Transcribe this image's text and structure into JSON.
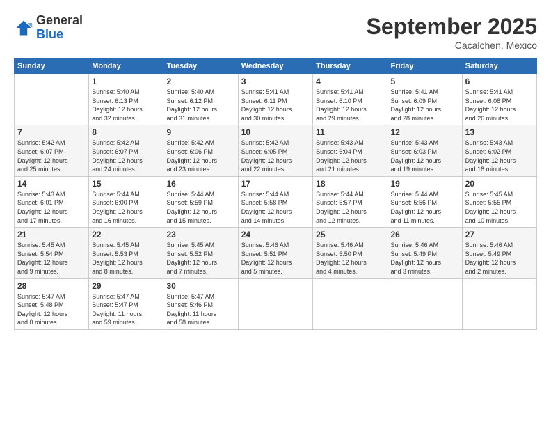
{
  "header": {
    "logo_general": "General",
    "logo_blue": "Blue",
    "month_title": "September 2025",
    "location": "Cacalchen, Mexico"
  },
  "weekdays": [
    "Sunday",
    "Monday",
    "Tuesday",
    "Wednesday",
    "Thursday",
    "Friday",
    "Saturday"
  ],
  "weeks": [
    [
      {
        "day": "",
        "info": ""
      },
      {
        "day": "1",
        "info": "Sunrise: 5:40 AM\nSunset: 6:13 PM\nDaylight: 12 hours\nand 32 minutes."
      },
      {
        "day": "2",
        "info": "Sunrise: 5:40 AM\nSunset: 6:12 PM\nDaylight: 12 hours\nand 31 minutes."
      },
      {
        "day": "3",
        "info": "Sunrise: 5:41 AM\nSunset: 6:11 PM\nDaylight: 12 hours\nand 30 minutes."
      },
      {
        "day": "4",
        "info": "Sunrise: 5:41 AM\nSunset: 6:10 PM\nDaylight: 12 hours\nand 29 minutes."
      },
      {
        "day": "5",
        "info": "Sunrise: 5:41 AM\nSunset: 6:09 PM\nDaylight: 12 hours\nand 28 minutes."
      },
      {
        "day": "6",
        "info": "Sunrise: 5:41 AM\nSunset: 6:08 PM\nDaylight: 12 hours\nand 26 minutes."
      }
    ],
    [
      {
        "day": "7",
        "info": "Sunrise: 5:42 AM\nSunset: 6:07 PM\nDaylight: 12 hours\nand 25 minutes."
      },
      {
        "day": "8",
        "info": "Sunrise: 5:42 AM\nSunset: 6:07 PM\nDaylight: 12 hours\nand 24 minutes."
      },
      {
        "day": "9",
        "info": "Sunrise: 5:42 AM\nSunset: 6:06 PM\nDaylight: 12 hours\nand 23 minutes."
      },
      {
        "day": "10",
        "info": "Sunrise: 5:42 AM\nSunset: 6:05 PM\nDaylight: 12 hours\nand 22 minutes."
      },
      {
        "day": "11",
        "info": "Sunrise: 5:43 AM\nSunset: 6:04 PM\nDaylight: 12 hours\nand 21 minutes."
      },
      {
        "day": "12",
        "info": "Sunrise: 5:43 AM\nSunset: 6:03 PM\nDaylight: 12 hours\nand 19 minutes."
      },
      {
        "day": "13",
        "info": "Sunrise: 5:43 AM\nSunset: 6:02 PM\nDaylight: 12 hours\nand 18 minutes."
      }
    ],
    [
      {
        "day": "14",
        "info": "Sunrise: 5:43 AM\nSunset: 6:01 PM\nDaylight: 12 hours\nand 17 minutes."
      },
      {
        "day": "15",
        "info": "Sunrise: 5:44 AM\nSunset: 6:00 PM\nDaylight: 12 hours\nand 16 minutes."
      },
      {
        "day": "16",
        "info": "Sunrise: 5:44 AM\nSunset: 5:59 PM\nDaylight: 12 hours\nand 15 minutes."
      },
      {
        "day": "17",
        "info": "Sunrise: 5:44 AM\nSunset: 5:58 PM\nDaylight: 12 hours\nand 14 minutes."
      },
      {
        "day": "18",
        "info": "Sunrise: 5:44 AM\nSunset: 5:57 PM\nDaylight: 12 hours\nand 12 minutes."
      },
      {
        "day": "19",
        "info": "Sunrise: 5:44 AM\nSunset: 5:56 PM\nDaylight: 12 hours\nand 11 minutes."
      },
      {
        "day": "20",
        "info": "Sunrise: 5:45 AM\nSunset: 5:55 PM\nDaylight: 12 hours\nand 10 minutes."
      }
    ],
    [
      {
        "day": "21",
        "info": "Sunrise: 5:45 AM\nSunset: 5:54 PM\nDaylight: 12 hours\nand 9 minutes."
      },
      {
        "day": "22",
        "info": "Sunrise: 5:45 AM\nSunset: 5:53 PM\nDaylight: 12 hours\nand 8 minutes."
      },
      {
        "day": "23",
        "info": "Sunrise: 5:45 AM\nSunset: 5:52 PM\nDaylight: 12 hours\nand 7 minutes."
      },
      {
        "day": "24",
        "info": "Sunrise: 5:46 AM\nSunset: 5:51 PM\nDaylight: 12 hours\nand 5 minutes."
      },
      {
        "day": "25",
        "info": "Sunrise: 5:46 AM\nSunset: 5:50 PM\nDaylight: 12 hours\nand 4 minutes."
      },
      {
        "day": "26",
        "info": "Sunrise: 5:46 AM\nSunset: 5:49 PM\nDaylight: 12 hours\nand 3 minutes."
      },
      {
        "day": "27",
        "info": "Sunrise: 5:46 AM\nSunset: 5:49 PM\nDaylight: 12 hours\nand 2 minutes."
      }
    ],
    [
      {
        "day": "28",
        "info": "Sunrise: 5:47 AM\nSunset: 5:48 PM\nDaylight: 12 hours\nand 0 minutes."
      },
      {
        "day": "29",
        "info": "Sunrise: 5:47 AM\nSunset: 5:47 PM\nDaylight: 11 hours\nand 59 minutes."
      },
      {
        "day": "30",
        "info": "Sunrise: 5:47 AM\nSunset: 5:46 PM\nDaylight: 11 hours\nand 58 minutes."
      },
      {
        "day": "",
        "info": ""
      },
      {
        "day": "",
        "info": ""
      },
      {
        "day": "",
        "info": ""
      },
      {
        "day": "",
        "info": ""
      }
    ]
  ]
}
